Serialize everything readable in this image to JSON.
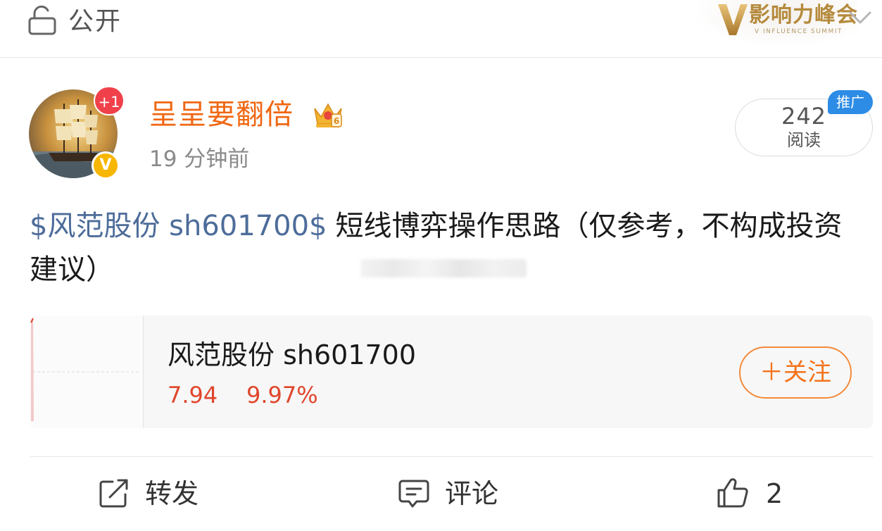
{
  "header": {
    "visibility_label": "公开",
    "banner_title": "影响力峰会",
    "banner_subtitle": "V INFLUENCE SUMMIT"
  },
  "post": {
    "author": "呈呈要翻倍",
    "avatar_badge": "+1",
    "verified_mark": "V",
    "timestamp": "19 分钟前",
    "read_count": "242",
    "read_label": "阅读",
    "promo_label": "推广",
    "stock_tag": "$风范股份 sh601700$",
    "text": "短线博弈操作思路（仅参考，不构成投资建议）"
  },
  "stock_card": {
    "name": "风范股份 sh601700",
    "price": "7.94",
    "change_pct": "9.97%",
    "follow_label": "＋关注"
  },
  "actions": {
    "repost_label": "转发",
    "comment_label": "评论",
    "like_count": "2"
  },
  "colors": {
    "username": "#f06712",
    "stock_tag": "#4d6c9a",
    "price_up": "#e0462c",
    "follow_border": "#f48a3a",
    "promo_badge": "#2d8ce6",
    "verified_badge": "#f7b600",
    "plus_badge": "#f0414b"
  }
}
